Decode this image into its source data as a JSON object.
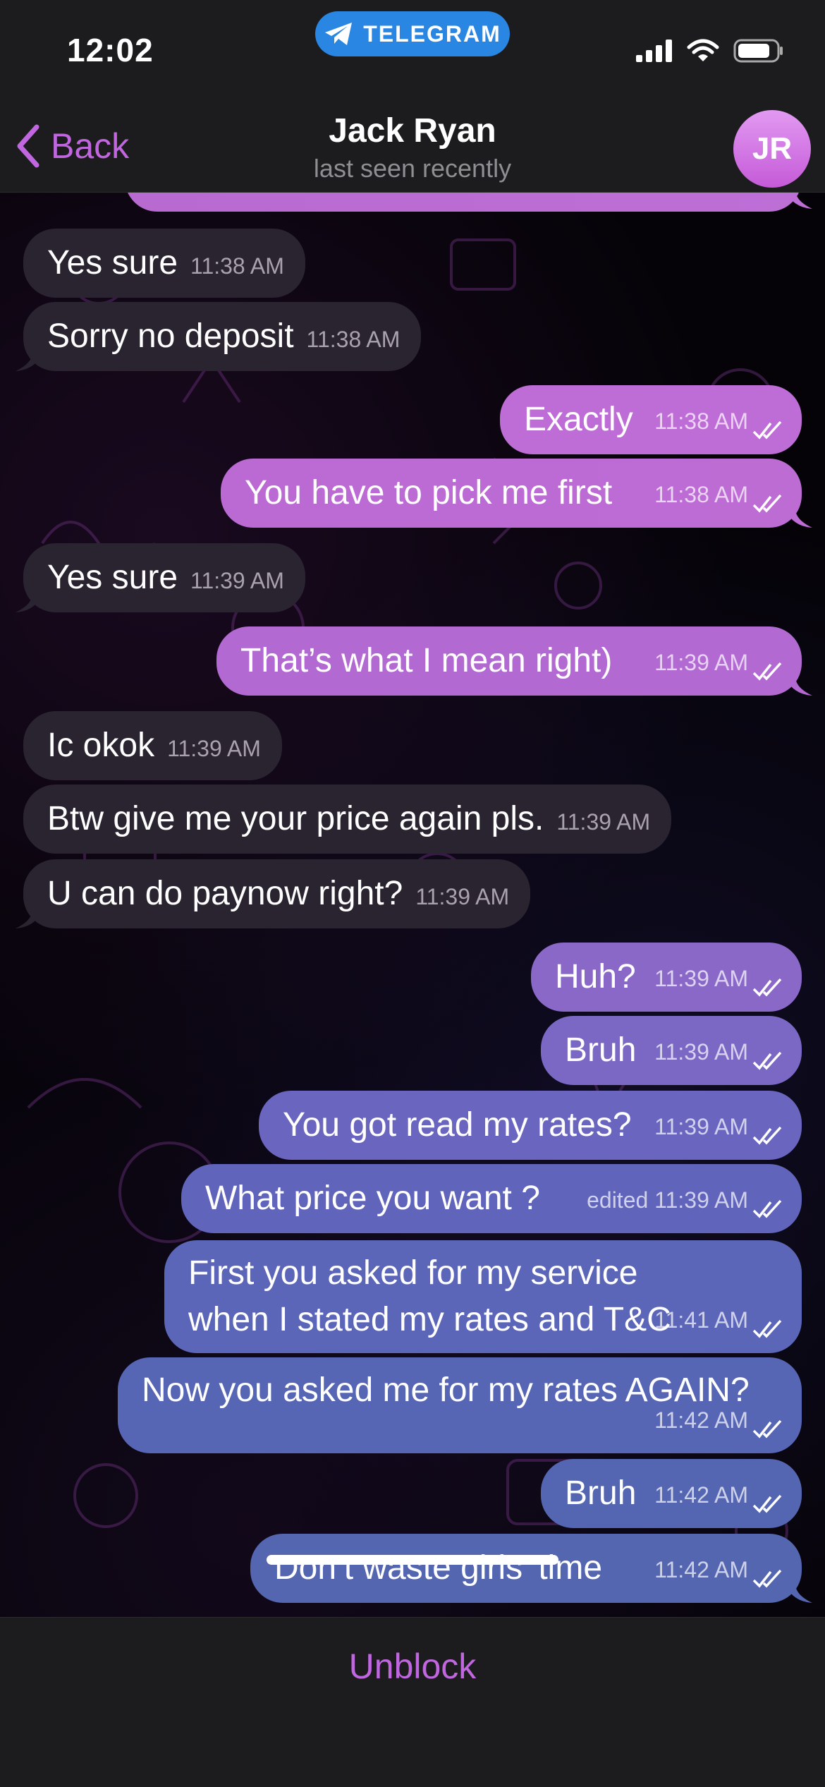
{
  "status_bar": {
    "time": "12:02",
    "app_pill": "TELEGRAM"
  },
  "header": {
    "back_label": "Back",
    "contact_name": "Jack Ryan",
    "contact_status": "last seen recently",
    "avatar_initials": "JR"
  },
  "messages": [
    {
      "dir": "in",
      "text": "Yes sure",
      "time": "11:38 AM"
    },
    {
      "dir": "in",
      "text": "Sorry no deposit",
      "time": "11:38 AM"
    },
    {
      "dir": "out",
      "text": "Exactly",
      "time": "11:38 AM"
    },
    {
      "dir": "out",
      "text": "You have to pick me first",
      "time": "11:38 AM"
    },
    {
      "dir": "in",
      "text": "Yes sure",
      "time": "11:39 AM"
    },
    {
      "dir": "out",
      "text": "That’s what I mean right)",
      "time": "11:39 AM"
    },
    {
      "dir": "in",
      "text": "Ic okok",
      "time": "11:39 AM"
    },
    {
      "dir": "in",
      "text": "Btw give me your price again pls.",
      "time": "11:39 AM"
    },
    {
      "dir": "in",
      "text": "U can do paynow right?",
      "time": "11:39 AM"
    },
    {
      "dir": "out",
      "text": "Huh?",
      "time": "11:39 AM"
    },
    {
      "dir": "out",
      "text": "Bruh",
      "time": "11:39 AM"
    },
    {
      "dir": "out",
      "text": "You got  read my rates?",
      "time": "11:39 AM"
    },
    {
      "dir": "out",
      "text": "What price you want ?",
      "time": "edited 11:39 AM"
    },
    {
      "dir": "out",
      "text": "First you asked for my service when I stated my rates and T&C",
      "time": "11:41 AM"
    },
    {
      "dir": "out",
      "text": "Now you asked me for my rates AGAIN?",
      "time": "11:42 AM"
    },
    {
      "dir": "out",
      "text": "Bruh",
      "time": "11:42 AM"
    },
    {
      "dir": "out",
      "text": "Don’t  waste girls’ time",
      "time": "11:42 AM"
    }
  ],
  "bottom": {
    "unblock_label": "Unblock"
  },
  "colors": {
    "accent": "#c067e0",
    "incoming": "#2a2430",
    "outgoing_top": "#b86ad0",
    "outgoing_bottom": "#5468b0"
  }
}
